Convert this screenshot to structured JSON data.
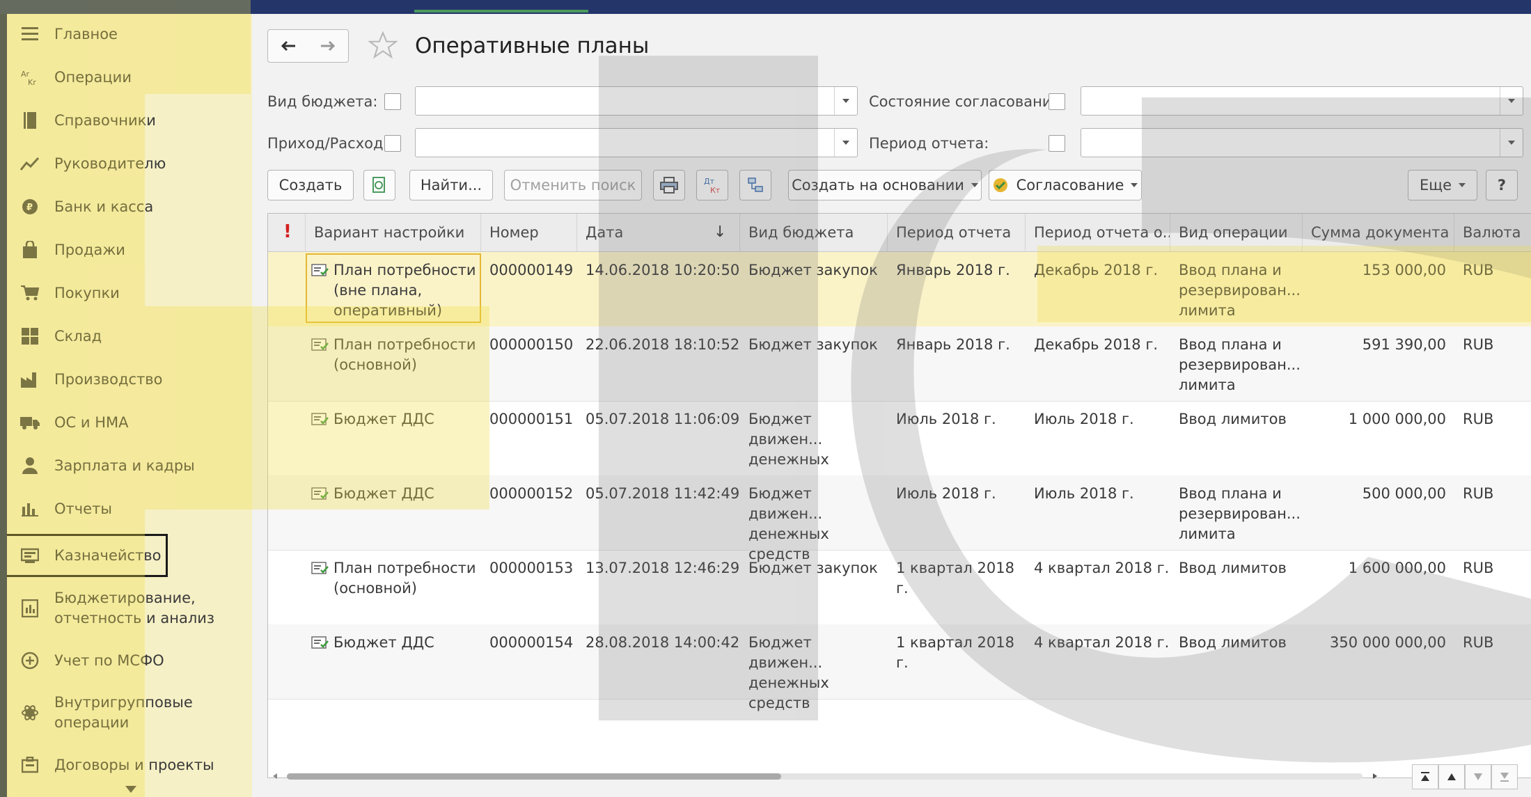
{
  "sidebar": {
    "items": [
      {
        "label": "Главное",
        "icon": "menu-icon"
      },
      {
        "label": "Операции",
        "icon": "operations-icon"
      },
      {
        "label": "Справочники",
        "icon": "book-icon"
      },
      {
        "label": "Руководителю",
        "icon": "trend-icon"
      },
      {
        "label": "Банк и касса",
        "icon": "coin-icon"
      },
      {
        "label": "Продажи",
        "icon": "bag-icon"
      },
      {
        "label": "Покупки",
        "icon": "cart-icon"
      },
      {
        "label": "Склад",
        "icon": "warehouse-icon"
      },
      {
        "label": "Производство",
        "icon": "factory-icon"
      },
      {
        "label": "ОС и НМА",
        "icon": "truck-icon"
      },
      {
        "label": "Зарплата и кадры",
        "icon": "person-icon"
      },
      {
        "label": "Отчеты",
        "icon": "bar-chart-icon"
      },
      {
        "label": "Казначейство",
        "icon": "treasury-icon",
        "active": true
      },
      {
        "label": "Бюджетирование,\nотчетность и анализ",
        "icon": "budget-icon"
      },
      {
        "label": "Учет по МСФО",
        "icon": "ifrs-icon"
      },
      {
        "label": "Внутригрупповые\nоперации",
        "icon": "group-icon"
      },
      {
        "label": "Договоры и проекты",
        "icon": "contract-icon"
      }
    ]
  },
  "header": {
    "title": "Оперативные планы",
    "close": "×"
  },
  "filters": {
    "budget_type_label": "Вид бюджета:",
    "income_expense_label": "Приход/Расход:",
    "approval_state_label": "Состояние согласования:",
    "report_period_label": "Период отчета:"
  },
  "toolbar": {
    "create": "Создать",
    "find": "Найти...",
    "cancel_search": "Отменить поиск",
    "create_based_on": "Создать на основании",
    "approval": "Согласование",
    "more": "Еще",
    "help": "?"
  },
  "table": {
    "columns": [
      "!",
      "Вариант настройки",
      "Номер",
      "Дата",
      "Вид бюджета",
      "Период отчета",
      "Период отчета о...",
      "Вид операции",
      "Сумма документа",
      "Валюта"
    ],
    "sort_indicator": "↓",
    "rows": [
      {
        "variant": "План потребности\n(вне плана,\nоперативный)",
        "number": "000000149",
        "date": "14.06.2018 10:20:50",
        "budget": "Бюджет закупок",
        "period": "Январь 2018 г.",
        "period_end": "Декабрь 2018 г.",
        "operation": "Ввод плана и\nрезервирован...\nлимита",
        "amount": "153 000,00",
        "currency": "RUB",
        "selected": true
      },
      {
        "variant": "План потребности\n(основной)",
        "number": "000000150",
        "date": "22.06.2018 18:10:52",
        "budget": "Бюджет закупок",
        "period": "Январь 2018 г.",
        "period_end": "Декабрь 2018 г.",
        "operation": "Ввод плана и\nрезервирован...\nлимита",
        "amount": "591 390,00",
        "currency": "RUB"
      },
      {
        "variant": "Бюджет ДДС",
        "number": "000000151",
        "date": "05.07.2018 11:06:09",
        "budget": "Бюджет движен...\nденежных\nсредств",
        "period": "Июль 2018 г.",
        "period_end": "Июль 2018 г.",
        "operation": "Ввод лимитов",
        "amount": "1 000 000,00",
        "currency": "RUB"
      },
      {
        "variant": "Бюджет ДДС",
        "number": "000000152",
        "date": "05.07.2018 11:42:49",
        "budget": "Бюджет движен...\nденежных\nсредств",
        "period": "Июль 2018 г.",
        "period_end": "Июль 2018 г.",
        "operation": "Ввод плана и\nрезервирован...\nлимита",
        "amount": "500 000,00",
        "currency": "RUB"
      },
      {
        "variant": "План потребности\n(основной)",
        "number": "000000153",
        "date": "13.07.2018 12:46:29",
        "budget": "Бюджет закупок",
        "period": "1 квартал 2018 г.",
        "period_end": "4 квартал 2018 г.",
        "operation": "Ввод лимитов",
        "amount": "1 600 000,00",
        "currency": "RUB"
      },
      {
        "variant": "Бюджет ДДС",
        "number": "000000154",
        "date": "28.08.2018 14:00:42",
        "budget": "Бюджет движен...\nденежных\nсредств",
        "period": "1 квартал 2018 г.",
        "period_end": "4 квартал 2018 г.",
        "operation": "Ввод лимитов",
        "amount": "350 000 000,00",
        "currency": "RUB"
      }
    ]
  },
  "colors": {
    "sidebar_bg": "#f6f0c6",
    "selected_row": "#fbf3c8",
    "focus_border": "#e3b833",
    "frame": "#1d2d58"
  }
}
